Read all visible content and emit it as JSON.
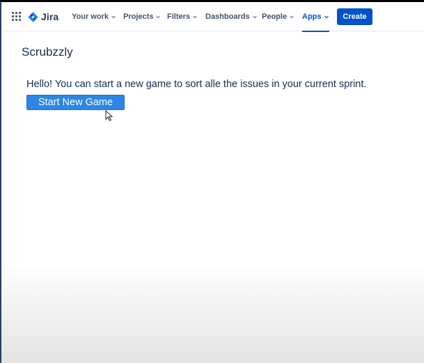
{
  "nav": {
    "logo_text": "Jira",
    "items": [
      {
        "label": "Your work",
        "active": false
      },
      {
        "label": "Projects",
        "active": false
      },
      {
        "label": "Filters",
        "active": false
      },
      {
        "label": "Dashboards",
        "active": false
      },
      {
        "label": "People",
        "active": false
      },
      {
        "label": "Apps",
        "active": true
      }
    ],
    "create_label": "Create",
    "icons": {
      "app_switcher": "grid-icon",
      "logo": "jira-logo-icon",
      "dropdown": "chevron-down-icon"
    },
    "colors": {
      "brand": "#0052cc",
      "text": "#42526e"
    }
  },
  "page": {
    "title": "Scrubzzly",
    "intro_text": "Hello! You can start a new game to sort alle the issues in your current sprint.",
    "start_button_label": "Start New Game",
    "colors": {
      "start_button": "#2b86e4"
    }
  }
}
